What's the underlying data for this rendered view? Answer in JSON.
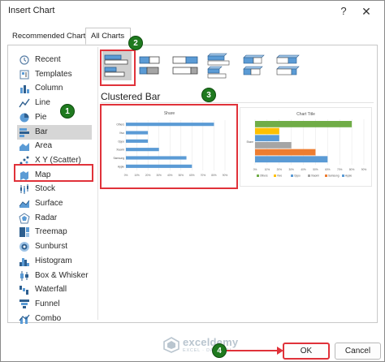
{
  "window": {
    "title": "Insert Chart",
    "help_glyph": "?",
    "close_glyph": "✕"
  },
  "tabs": [
    {
      "label": "Recommended Charts",
      "selected": false
    },
    {
      "label": "All Charts",
      "selected": true
    }
  ],
  "sidebar": {
    "items": [
      {
        "label": "Recent",
        "icon": "recent-icon"
      },
      {
        "label": "Templates",
        "icon": "templates-icon"
      },
      {
        "label": "Column",
        "icon": "column-chart-icon"
      },
      {
        "label": "Line",
        "icon": "line-chart-icon"
      },
      {
        "label": "Pie",
        "icon": "pie-chart-icon"
      },
      {
        "label": "Bar",
        "icon": "bar-chart-icon",
        "selected": true
      },
      {
        "label": "Area",
        "icon": "area-chart-icon"
      },
      {
        "label": "X Y (Scatter)",
        "icon": "scatter-chart-icon"
      },
      {
        "label": "Map",
        "icon": "map-chart-icon"
      },
      {
        "label": "Stock",
        "icon": "stock-chart-icon"
      },
      {
        "label": "Surface",
        "icon": "surface-chart-icon"
      },
      {
        "label": "Radar",
        "icon": "radar-chart-icon"
      },
      {
        "label": "Treemap",
        "icon": "treemap-chart-icon"
      },
      {
        "label": "Sunburst",
        "icon": "sunburst-chart-icon"
      },
      {
        "label": "Histogram",
        "icon": "histogram-chart-icon"
      },
      {
        "label": "Box & Whisker",
        "icon": "box-whisker-chart-icon"
      },
      {
        "label": "Waterfall",
        "icon": "waterfall-chart-icon"
      },
      {
        "label": "Funnel",
        "icon": "funnel-chart-icon"
      },
      {
        "label": "Combo",
        "icon": "combo-chart-icon"
      }
    ]
  },
  "subtypes": [
    {
      "icon": "clustered-bar-icon",
      "selected": true
    },
    {
      "icon": "stacked-bar-icon"
    },
    {
      "icon": "100-stacked-bar-icon"
    },
    {
      "icon": "3d-clustered-bar-icon"
    },
    {
      "icon": "3d-stacked-bar-icon"
    },
    {
      "icon": "3d-100-stacked-bar-icon"
    }
  ],
  "section_title": "Clustered Bar",
  "badges": [
    "1",
    "2",
    "3",
    "4"
  ],
  "colors": {
    "accent_red": "#e0323a",
    "badge_green": "#1f7a1f",
    "bar_blue": "#5b9bd5",
    "orange": "#ed7d31",
    "gray": "#a5a5a5",
    "gold": "#ffc000",
    "green": "#70ad47"
  },
  "chart_data": [
    {
      "type": "bar",
      "title": "Share",
      "categories": [
        "Others",
        "Vivo",
        "Oppo",
        "Xiaomi",
        "Samsung",
        "Apple"
      ],
      "values": [
        0.8,
        0.2,
        0.2,
        0.3,
        0.55,
        0.6
      ],
      "xticks": [
        "0%",
        "10%",
        "20%",
        "30%",
        "40%",
        "50%",
        "60%",
        "70%",
        "80%",
        "90%"
      ],
      "xlim": [
        0,
        0.9
      ],
      "grid": true
    },
    {
      "type": "bar",
      "title": "Chart Title",
      "categories": [
        "Share"
      ],
      "series": [
        {
          "name": "Others",
          "value": 0.8,
          "color": "#70ad47"
        },
        {
          "name": "Vivo",
          "value": 0.2,
          "color": "#ffc000"
        },
        {
          "name": "Oppo",
          "value": 0.2,
          "color": "#5b9bd5"
        },
        {
          "name": "Xiaomi",
          "value": 0.3,
          "color": "#a5a5a5"
        },
        {
          "name": "Samsung",
          "value": 0.5,
          "color": "#ed7d31"
        },
        {
          "name": "Apple",
          "value": 0.6,
          "color": "#5b9bd5"
        }
      ],
      "xticks": [
        "0%",
        "10%",
        "20%",
        "30%",
        "40%",
        "50%",
        "60%",
        "70%",
        "80%",
        "90%"
      ],
      "xlim": [
        0,
        0.9
      ],
      "legend": "bottom",
      "grid": true
    }
  ],
  "watermark": {
    "name": "exceldemy",
    "tagline": "EXCEL · DATA · BI"
  },
  "buttons": {
    "ok": "OK",
    "cancel": "Cancel"
  }
}
